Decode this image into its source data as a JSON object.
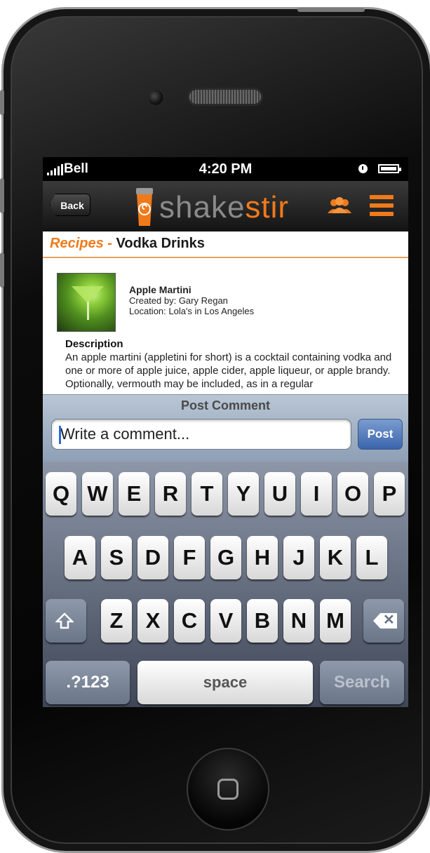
{
  "status_bar": {
    "carrier": "Bell",
    "time": "4:20 PM"
  },
  "nav": {
    "back_label": "Back",
    "logo_part1": "shake",
    "logo_part2": "stir"
  },
  "heading": {
    "category": "Recipes",
    "separator": "-",
    "title": "Vodka Drinks"
  },
  "recipe": {
    "name": "Apple Martini",
    "created_by": "Created by: Gary Regan",
    "location": "Location: Lola's in Los Angeles",
    "description_title": "Description",
    "description": "An apple martini (appletini for short) is a cocktail containing vodka and one or more of apple juice, apple cider, apple liqueur, or apple brandy. Optionally, vermouth may be included, as in a regular"
  },
  "comment": {
    "title": "Post Comment",
    "placeholder": "Write a comment...",
    "post_label": "Post"
  },
  "keyboard": {
    "row1": [
      "Q",
      "W",
      "E",
      "R",
      "T",
      "Y",
      "U",
      "I",
      "O",
      "P"
    ],
    "row2": [
      "A",
      "S",
      "D",
      "F",
      "G",
      "H",
      "J",
      "K",
      "L"
    ],
    "row3": [
      "Z",
      "X",
      "C",
      "V",
      "B",
      "N",
      "M"
    ],
    "numbers_label": ".?123",
    "space_label": "space",
    "search_label": "Search"
  },
  "colors": {
    "accent": "#f07a1a",
    "post_button": "#4a75bb",
    "nav_bg": "#1e1e1e"
  },
  "icons": [
    "signal-icon",
    "alarm-icon",
    "battery-icon",
    "people-icon",
    "menu-icon",
    "shift-icon",
    "backspace-icon",
    "home-button-icon"
  ]
}
